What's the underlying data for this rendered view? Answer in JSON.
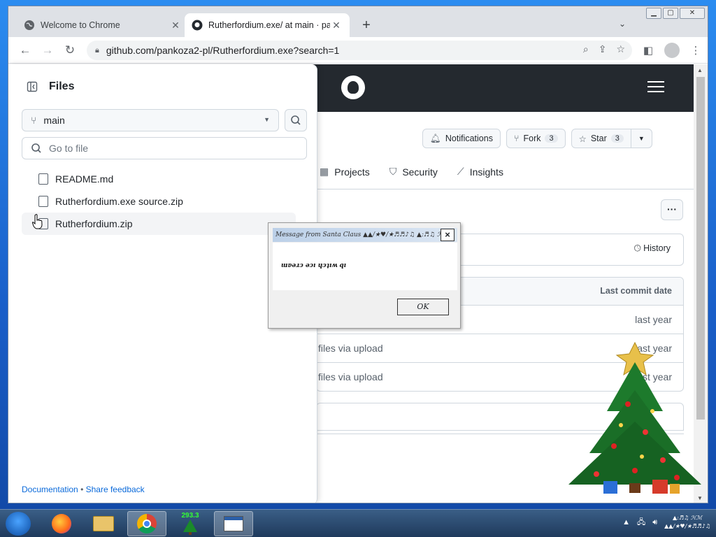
{
  "browser": {
    "tabs": [
      {
        "title": "Welcome to Chrome",
        "active": false
      },
      {
        "title": "Rutherfordium.exe/ at main · pan",
        "active": true
      }
    ],
    "url": "github.com/pankoza2-pl/Rutherfordium.exe?search=1"
  },
  "repo": {
    "actions": {
      "notifications": "Notifications",
      "fork_label": "Fork",
      "fork_count": "3",
      "star_label": "Star",
      "star_count": "3"
    },
    "nav": [
      "Projects",
      "Security",
      "Insights"
    ],
    "history_label": "History",
    "table_header": "Last commit date",
    "rows": [
      {
        "message": "",
        "date": "last year"
      },
      {
        "message": "files via upload",
        "date": "last year"
      },
      {
        "message": "files via upload",
        "date": "last year"
      }
    ]
  },
  "files_panel": {
    "title": "Files",
    "branch": "main",
    "goto_placeholder": "Go to file",
    "files": [
      "README.md",
      "Rutherfordium.exe source.zip",
      "Rutherfordium.zip"
    ],
    "footer_docs": "Documentation",
    "footer_sep": "•",
    "footer_feedback": "Share feedback"
  },
  "dialog": {
    "title": "Message from Santa Claus ▲▲/★♥/★♬♬♪♫ ▲:♬♫ ℋℳ",
    "message": "ɯɐǝɹɔ ǝɔı ɥɔʇıʍ qı",
    "ok_label": "OK",
    "close_label": "×"
  },
  "taskbar": {
    "tree_counter": "293.3",
    "tray_line1": "▲:♬♫ ℋℳ",
    "tray_line2": "▲▲/★♥/★♬♬♪♫"
  }
}
